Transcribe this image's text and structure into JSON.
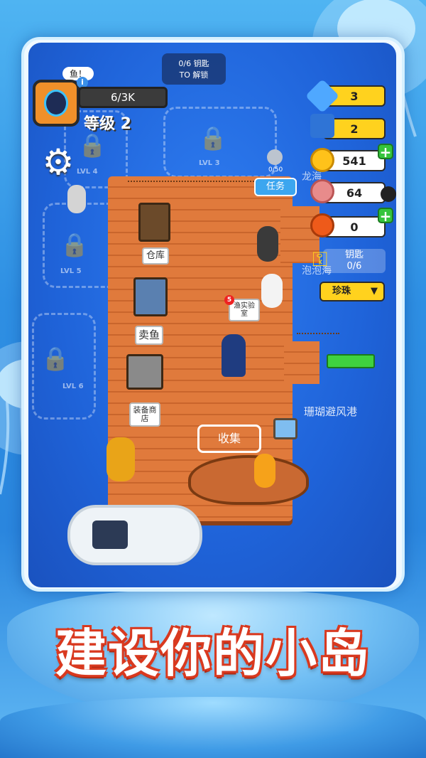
{
  "hud": {
    "player_level_value": "6/3K",
    "level_label": "等级 2",
    "speech_bubble": "鱼！",
    "key_progress": "0/6 钥匙",
    "key_unlock": "TO 解锁",
    "task_label": "任务",
    "task_counter": "0/50"
  },
  "resources": {
    "diamond": "3",
    "card": "2",
    "coin": "541",
    "meat": "64",
    "fruit": "0",
    "key_label": "钥匙",
    "key_value": "0/6",
    "dropdown": "珍珠"
  },
  "map": {
    "lock_lvl3": "LVL 3",
    "lock_lvl4": "LVL 4",
    "lock_lvl5": "LVL 5",
    "lock_lvl6": "LVL 6",
    "area_dragon": "龙海",
    "area_bubble": "泡泡海",
    "area_harbor": "珊瑚避风港"
  },
  "dock": {
    "warehouse_sign": "仓库",
    "sell_fish_sign": "卖鱼",
    "equipment_store_sign": "装备商店",
    "lab_sign": "渔实验室",
    "lab_badge": "5",
    "collect_label": "收集"
  },
  "banner": {
    "title": "建设你的小岛"
  }
}
